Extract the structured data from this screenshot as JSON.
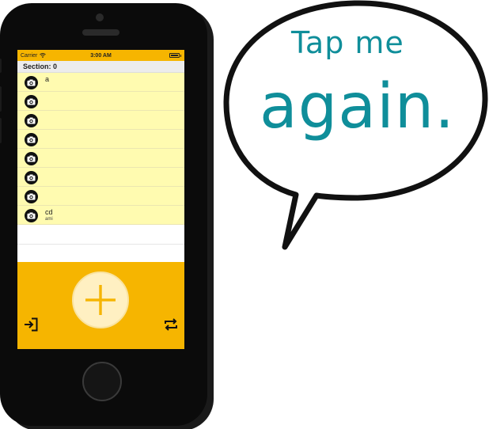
{
  "status_bar": {
    "carrier": "Carrier",
    "time": "3:00 AM"
  },
  "table": {
    "section_header": "Section: 0",
    "rows": [
      {
        "title": "a",
        "subtitle": ""
      },
      {
        "title": "",
        "subtitle": ""
      },
      {
        "title": "",
        "subtitle": ""
      },
      {
        "title": "",
        "subtitle": ""
      },
      {
        "title": "",
        "subtitle": ""
      },
      {
        "title": "",
        "subtitle": ""
      },
      {
        "title": "",
        "subtitle": ""
      },
      {
        "title": "cd",
        "subtitle": "ami"
      }
    ],
    "row_icon": "camera-icon"
  },
  "toolbar": {
    "add_icon": "plus-icon",
    "left_icon": "sign-in-icon",
    "right_icon": "repeat-icon"
  },
  "bubble": {
    "line1": "Tap me",
    "line2": "again."
  },
  "colors": {
    "accent": "#f6b500",
    "row_background": "#fffbb0",
    "bubble_text": "#0f8e9a"
  }
}
